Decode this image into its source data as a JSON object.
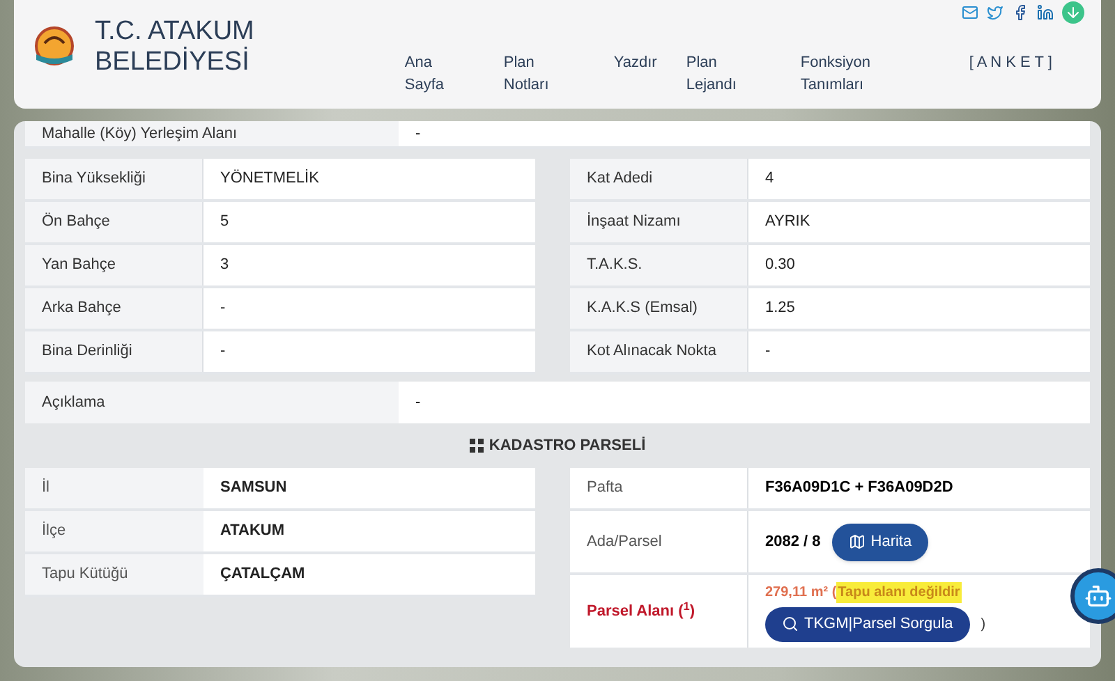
{
  "header": {
    "title_lines": [
      "T.C. ATAKUM",
      "BELEDİYESİ"
    ],
    "nav": [
      "Ana Sayfa",
      "Plan Notları",
      "Yazdır",
      "Plan Lejandı",
      "Fonksiyon Tanımları",
      "[ A N K E T ]"
    ],
    "social": [
      {
        "kind": "email"
      },
      {
        "kind": "twitter"
      },
      {
        "kind": "facebook"
      },
      {
        "kind": "linkedin"
      },
      {
        "kind": "download"
      }
    ]
  },
  "top_row": {
    "label": "Mahalle (Köy) Yerleşim Alanı",
    "value": "-"
  },
  "left_table": [
    {
      "label": "Bina Yüksekliği",
      "value": "YÖNETMELİK"
    },
    {
      "label": "Ön Bahçe",
      "value": "5"
    },
    {
      "label": "Yan Bahçe",
      "value": "3"
    },
    {
      "label": "Arka Bahçe",
      "value": "-"
    },
    {
      "label": "Bina Derinliği",
      "value": "-"
    }
  ],
  "right_table": [
    {
      "label": "Kat Adedi",
      "value": "4"
    },
    {
      "label": "İnşaat Nizamı",
      "value": "AYRIK"
    },
    {
      "label": "T.A.K.S.",
      "value": "0.30"
    },
    {
      "label": "K.A.K.S (Emsal)",
      "value": "1.25"
    },
    {
      "label": "Kot Alınacak Nokta",
      "value": "-"
    }
  ],
  "description_row": {
    "label": "Açıklama",
    "value": "-"
  },
  "kadastro": {
    "title": "KADASTRO PARSELİ",
    "left": [
      {
        "label": "İl",
        "value": "SAMSUN"
      },
      {
        "label": "İlçe",
        "value": "ATAKUM"
      },
      {
        "label": "Tapu Kütüğü",
        "value": "ÇATALÇAM"
      }
    ],
    "pafta": {
      "label": "Pafta",
      "value": "F36A09D1C + F36A09D2D"
    },
    "ada_parsel": {
      "label": "Ada/Parsel",
      "value": "2082 / 8",
      "button": "Harita"
    },
    "parsel_alani": {
      "label": "Parsel Alanı ($^{1}$)",
      "area": "279,11 m² (",
      "note": "Tapu alanı değildir",
      "button": "TKGM|Parsel Sorgula",
      "close": ")"
    }
  }
}
